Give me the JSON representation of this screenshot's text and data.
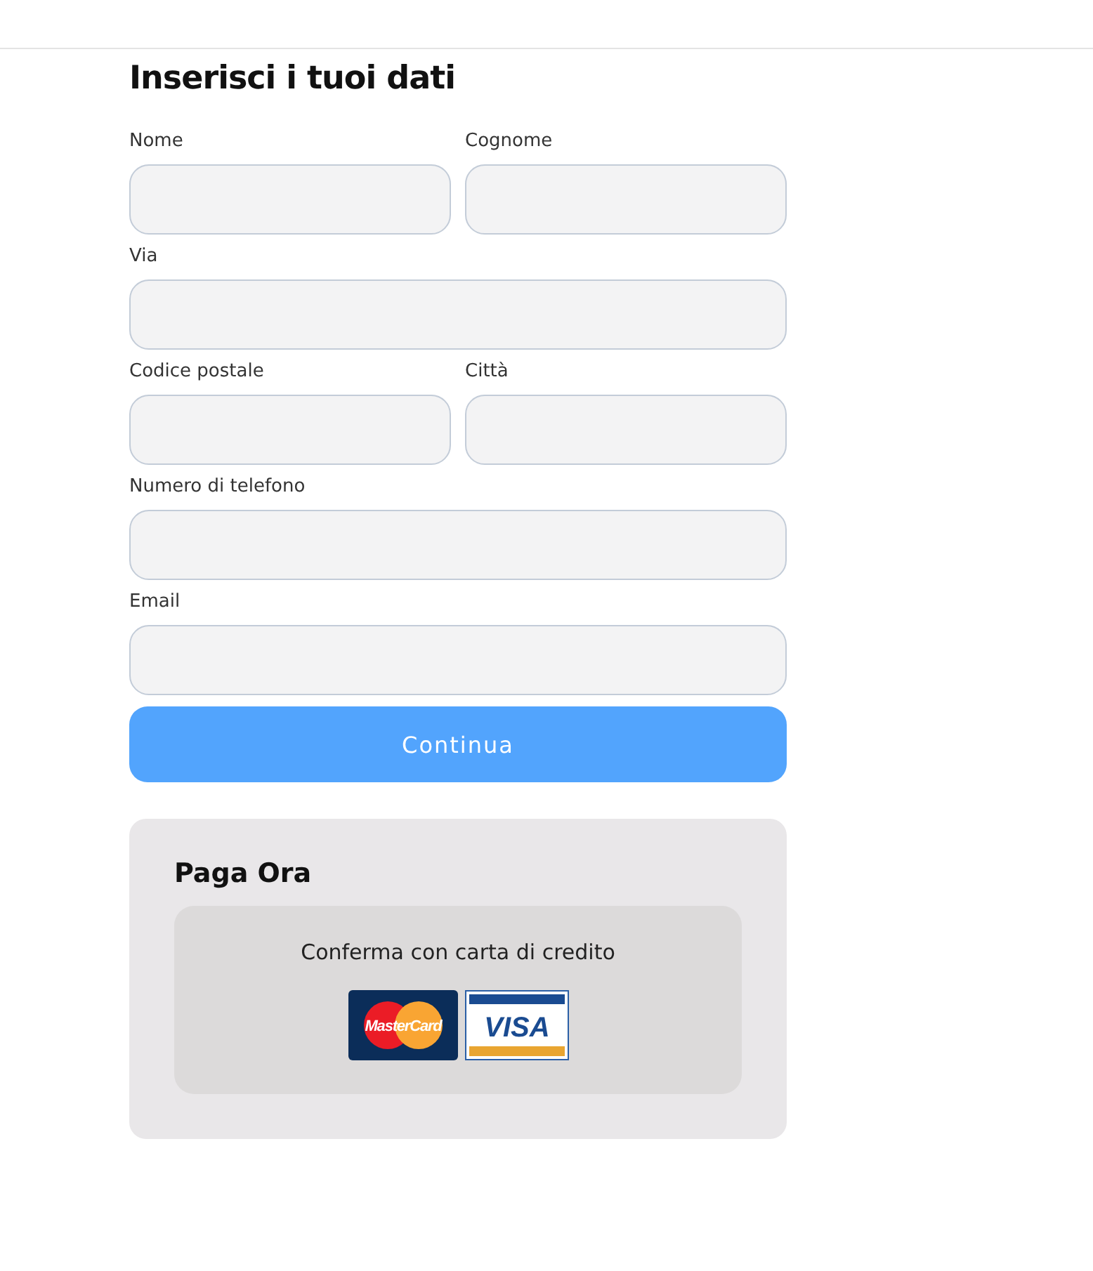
{
  "title": "Inserisci i tuoi dati",
  "rows": [
    [
      {
        "label": "Nome"
      },
      {
        "label": "Cognome"
      }
    ],
    [
      {
        "label": "Via"
      }
    ],
    [
      {
        "label": "Codice postale"
      },
      {
        "label": "Città"
      }
    ],
    [
      {
        "label": "Numero di telefono"
      }
    ],
    [
      {
        "label": "Email"
      }
    ]
  ],
  "submit": "Continua",
  "payment": {
    "title": "Paga Ora",
    "prompt": "Conferma con carta di credito",
    "cards": [
      {
        "kind": "mastercard",
        "text": "MasterCard"
      },
      {
        "kind": "visa",
        "text": "VISA"
      }
    ]
  }
}
